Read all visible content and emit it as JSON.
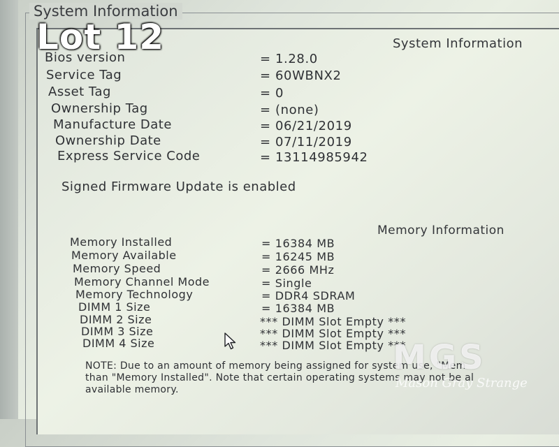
{
  "frame_title": "System Information",
  "overlay_label": "Lot 12",
  "system_section": {
    "title": "System Information",
    "rows": [
      {
        "label": "Bios version",
        "value": "= 1.28.0"
      },
      {
        "label": "Service Tag",
        "value": "= 60WBNX2"
      },
      {
        "label": "Asset Tag",
        "value": "= 0"
      },
      {
        "label": "Ownership Tag",
        "value": "= (none)"
      },
      {
        "label": "Manufacture Date",
        "value": "= 06/21/2019"
      },
      {
        "label": "Ownership Date",
        "value": "= 07/11/2019"
      },
      {
        "label": "Express Service Code",
        "value": "= 13114985942"
      }
    ],
    "firmware_status": "Signed Firmware Update is enabled"
  },
  "memory_section": {
    "title": "Memory Information",
    "rows": [
      {
        "label": "Memory Installed",
        "value": "= 16384 MB"
      },
      {
        "label": "Memory Available",
        "value": "= 16245 MB"
      },
      {
        "label": "Memory Speed",
        "value": "= 2666 MHz"
      },
      {
        "label": "Memory Channel Mode",
        "value": "= Single"
      },
      {
        "label": "Memory Technology",
        "value": "= DDR4 SDRAM"
      },
      {
        "label": "DIMM 1 Size",
        "value": "= 16384 MB"
      },
      {
        "label": "DIMM 2 Size",
        "value": "*** DIMM Slot Empty ***"
      },
      {
        "label": "DIMM 3 Size",
        "value": "*** DIMM Slot Empty ***"
      },
      {
        "label": "DIMM 4 Size",
        "value": "*** DIMM Slot Empty ***"
      }
    ]
  },
  "note": {
    "line1": "NOTE: Due to an amount of memory being assigned for system use, \"Mem",
    "line2": "than \"Memory Installed\". Note that certain operating systems may not be al",
    "line3": "available memory."
  },
  "watermark": {
    "logo": "MGS",
    "subtitle": "Mason Gray Strange"
  },
  "icons": {
    "cursor": "mouse-pointer-icon"
  }
}
